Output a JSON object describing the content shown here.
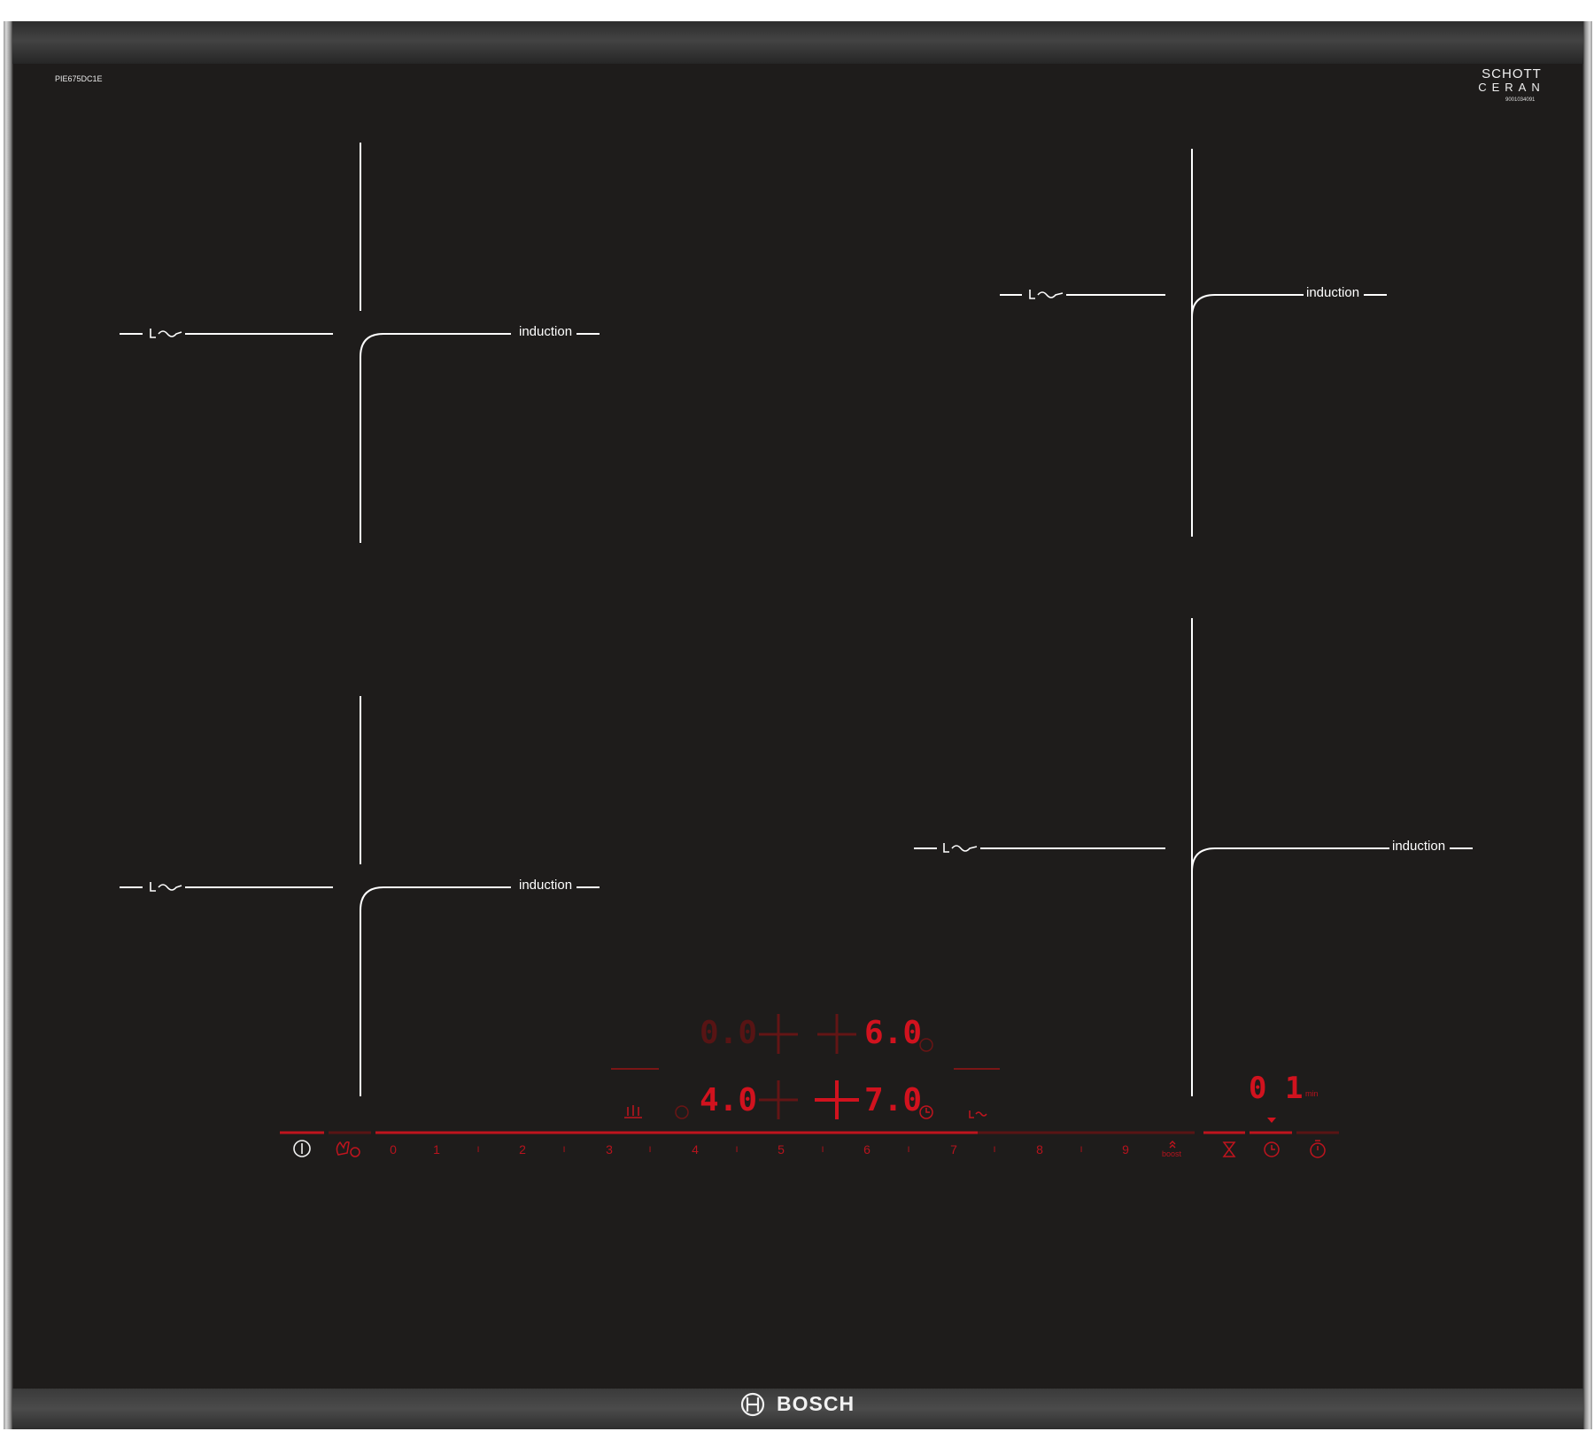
{
  "panel": {
    "model": "PIE675DC1E",
    "glass_brand_line1": "SCHOTT",
    "glass_brand_line2": "CERAN",
    "serial": "9001034091",
    "logo_text": "BOSCH"
  },
  "zones": {
    "front_left_label": "induction",
    "rear_left_label": "induction",
    "rear_right_label": "induction",
    "front_right_label": "induction"
  },
  "display": {
    "rear_left_level": "0.0",
    "rear_right_level": "6.0",
    "front_left_level": "4.0",
    "front_right_level": "7.0",
    "timer_minutes": "0 1",
    "timer_unit": "min"
  },
  "slider": {
    "levels": [
      "0",
      "1",
      "2",
      "3",
      "4",
      "5",
      "6",
      "7",
      "8",
      "9"
    ],
    "boost_label": "boost"
  },
  "colors": {
    "glass": "#1e1c1b",
    "display_red": "#d1121e",
    "marking_white": "#ffffff"
  }
}
